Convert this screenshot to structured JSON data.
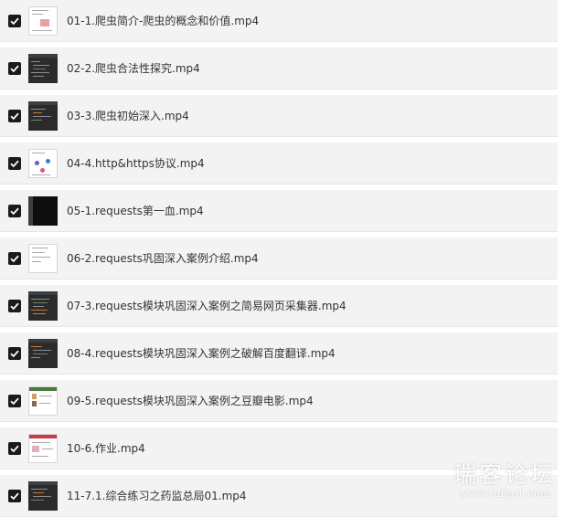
{
  "files": [
    {
      "name": "01-1.爬虫简介-爬虫的概念和价值.mp4",
      "checked": true,
      "thumbnail": "light-slide-thumbnail"
    },
    {
      "name": "02-2.爬虫合法性探究.mp4",
      "checked": true,
      "thumbnail": "dark-code-thumbnail"
    },
    {
      "name": "03-3.爬虫初始深入.mp4",
      "checked": true,
      "thumbnail": "dark-code-thumbnail"
    },
    {
      "name": "04-4.http&https协议.mp4",
      "checked": true,
      "thumbnail": "light-diagram-thumbnail"
    },
    {
      "name": "05-1.requests第一血.mp4",
      "checked": true,
      "thumbnail": "black-editor-thumbnail"
    },
    {
      "name": "06-2.requests巩固深入案例介绍.mp4",
      "checked": true,
      "thumbnail": "light-slide-thumbnail"
    },
    {
      "name": "07-3.requests模块巩固深入案例之简易网页采集器.mp4",
      "checked": true,
      "thumbnail": "dark-code-thumbnail"
    },
    {
      "name": "08-4.requests模块巩固深入案例之破解百度翻译.mp4",
      "checked": true,
      "thumbnail": "dark-code-thumbnail"
    },
    {
      "name": "09-5.requests模块巩固深入案例之豆瓣电影.mp4",
      "checked": true,
      "thumbnail": "light-webpage-thumbnail"
    },
    {
      "name": "10-6.作业.mp4",
      "checked": true,
      "thumbnail": "light-webpage-thumbnail"
    },
    {
      "name": "11-7.1.综合练习之药监总局01.mp4",
      "checked": true,
      "thumbnail": "dark-code-thumbnail"
    }
  ],
  "watermark": {
    "text": "瑞客论坛",
    "url": "www.ruike1.com"
  },
  "colors": {
    "row_background": "#f3f3f3",
    "checkbox": "#1a1a1a",
    "text": "#333333"
  }
}
